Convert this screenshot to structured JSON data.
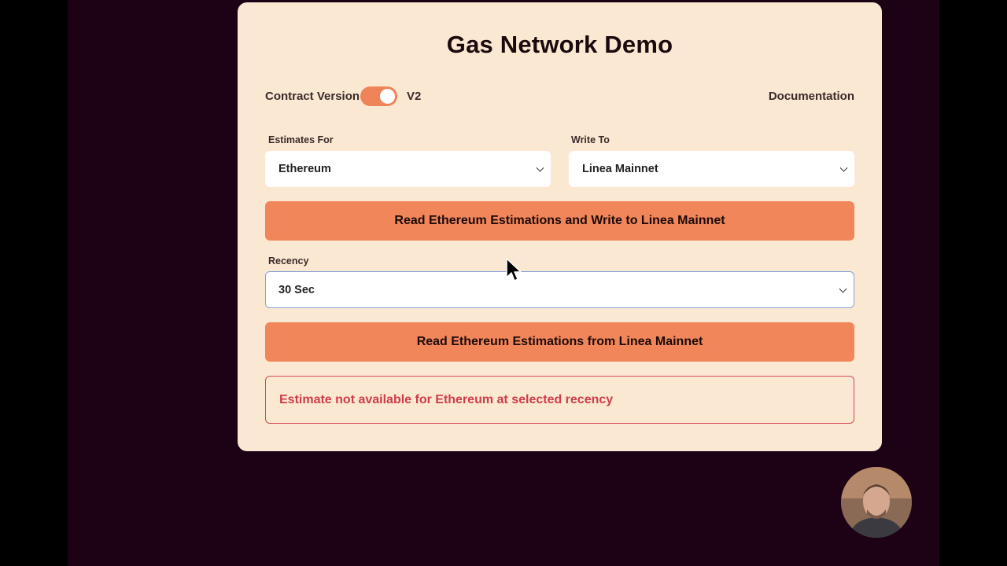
{
  "card": {
    "title": "Gas Network Demo",
    "contract_version_label": "Contract Version",
    "contract_version_toggle_on": true,
    "contract_version_value": "V2",
    "documentation_link": "Documentation"
  },
  "estimates_for": {
    "label": "Estimates For",
    "selected": "Ethereum"
  },
  "write_to": {
    "label": "Write To",
    "selected": "Linea Mainnet"
  },
  "write_button_label": "Read Ethereum Estimations and Write to Linea Mainnet",
  "recency": {
    "label": "Recency",
    "selected": "30 Sec"
  },
  "read_button_label": "Read Ethereum Estimations from Linea Mainnet",
  "error_message": "Estimate not available for Ethereum at selected recency",
  "colors": {
    "page_background": "#1d0216",
    "card_background": "#fbe8d2",
    "accent": "#f08659",
    "error": "#cc3d4d"
  }
}
